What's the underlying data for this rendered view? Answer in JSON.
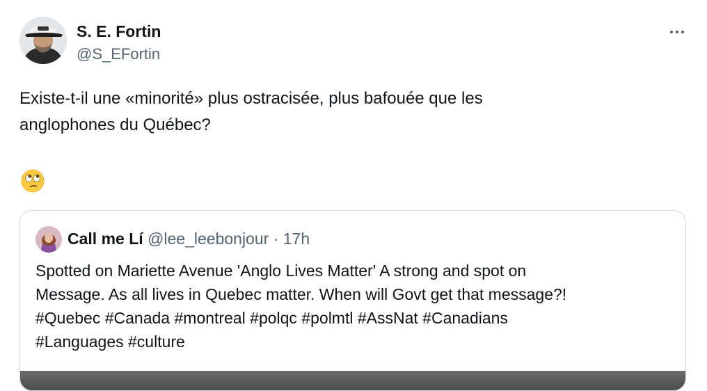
{
  "tweet": {
    "author": {
      "name": "S. E. Fortin",
      "handle": "@S_EFortin"
    },
    "text_lines": [
      "Existe-t-il une «minorité» plus ostracisée, plus bafouée que les",
      "anglophones du Québec?"
    ],
    "emoji": "face-with-rolling-eyes-emoji",
    "more_icon": "more-horizontal-icon"
  },
  "quote": {
    "author": {
      "name": "Call me Lí",
      "handle": "@lee_leebonjour",
      "separator": "·",
      "time": "17h"
    },
    "text_lines": [
      "Spotted on Mariette Avenue 'Anglo Lives Matter' A strong and spot on",
      "Message. As all lives in Quebec matter. When will Govt get that message?!",
      "#Quebec #Canada #montreal #polqc #polmtl #AssNat #Canadians",
      "#Languages #culture"
    ]
  },
  "colors": {
    "text": "#0f1419",
    "secondary": "#536471",
    "border": "#cfd9de",
    "emoji_yellow": "#fcca3f"
  }
}
